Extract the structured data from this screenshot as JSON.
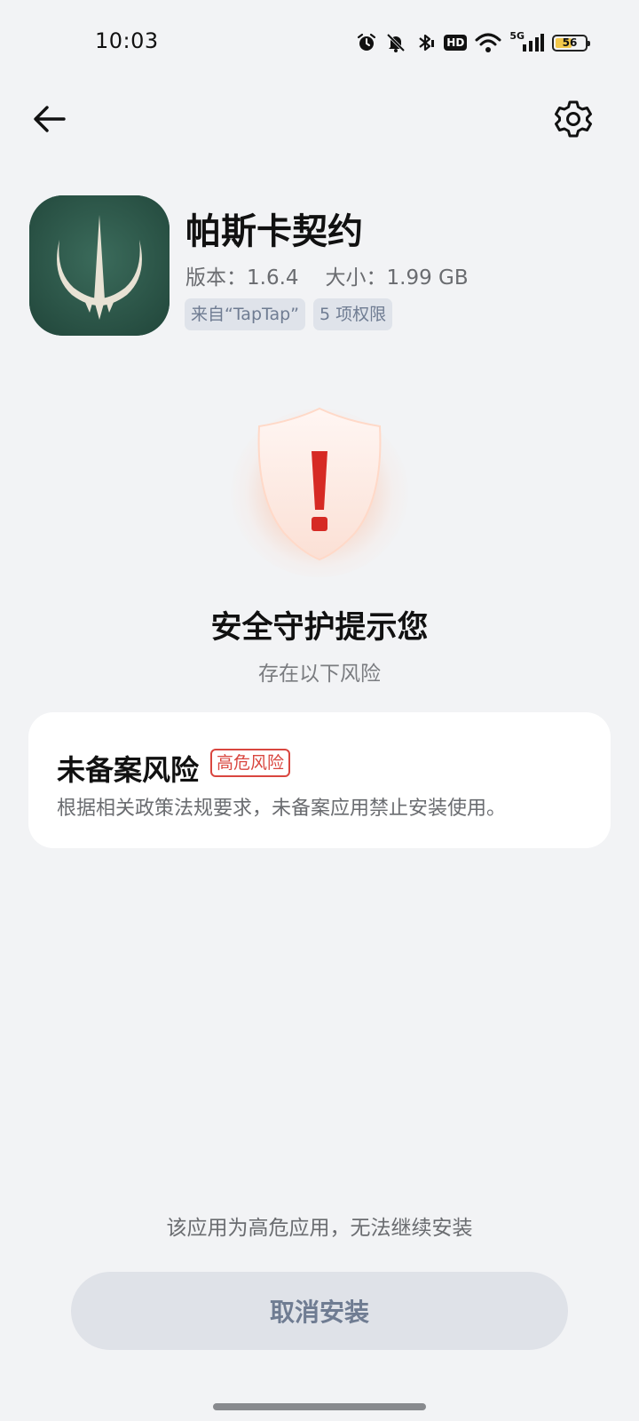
{
  "status_bar": {
    "time": "10:03",
    "network_label": "5G",
    "hd_label": "HD",
    "battery_level": "56",
    "battery_fraction": 0.56,
    "icons": [
      "alarm-icon",
      "mute-icon",
      "bluetooth-icon",
      "hd-icon",
      "wifi-icon",
      "cellular-signal-icon",
      "battery-icon"
    ]
  },
  "nav": {
    "back_icon": "back-arrow-icon",
    "settings_icon": "gear-icon"
  },
  "app": {
    "name": "帕斯卡契约",
    "version": "版本：1.6.4",
    "size": "大小：1.99 GB",
    "tags": [
      "来自“TapTap”",
      "5 项权限"
    ],
    "icon_colors": {
      "background": "#2f5a4c",
      "emblem": "#e8e2d4"
    }
  },
  "warning": {
    "icon": "shield-warning-icon",
    "title": "安全守护提示您",
    "subtitle": "存在以下风险"
  },
  "risk": {
    "title": "未备案风险",
    "badge": "高危风险",
    "description": "根据相关政策法规要求，未备案应用禁止安装使用。",
    "badge_color": "#d9463f"
  },
  "footer": {
    "note": "该应用为高危应用，无法继续安装",
    "cancel_label": "取消安装"
  }
}
